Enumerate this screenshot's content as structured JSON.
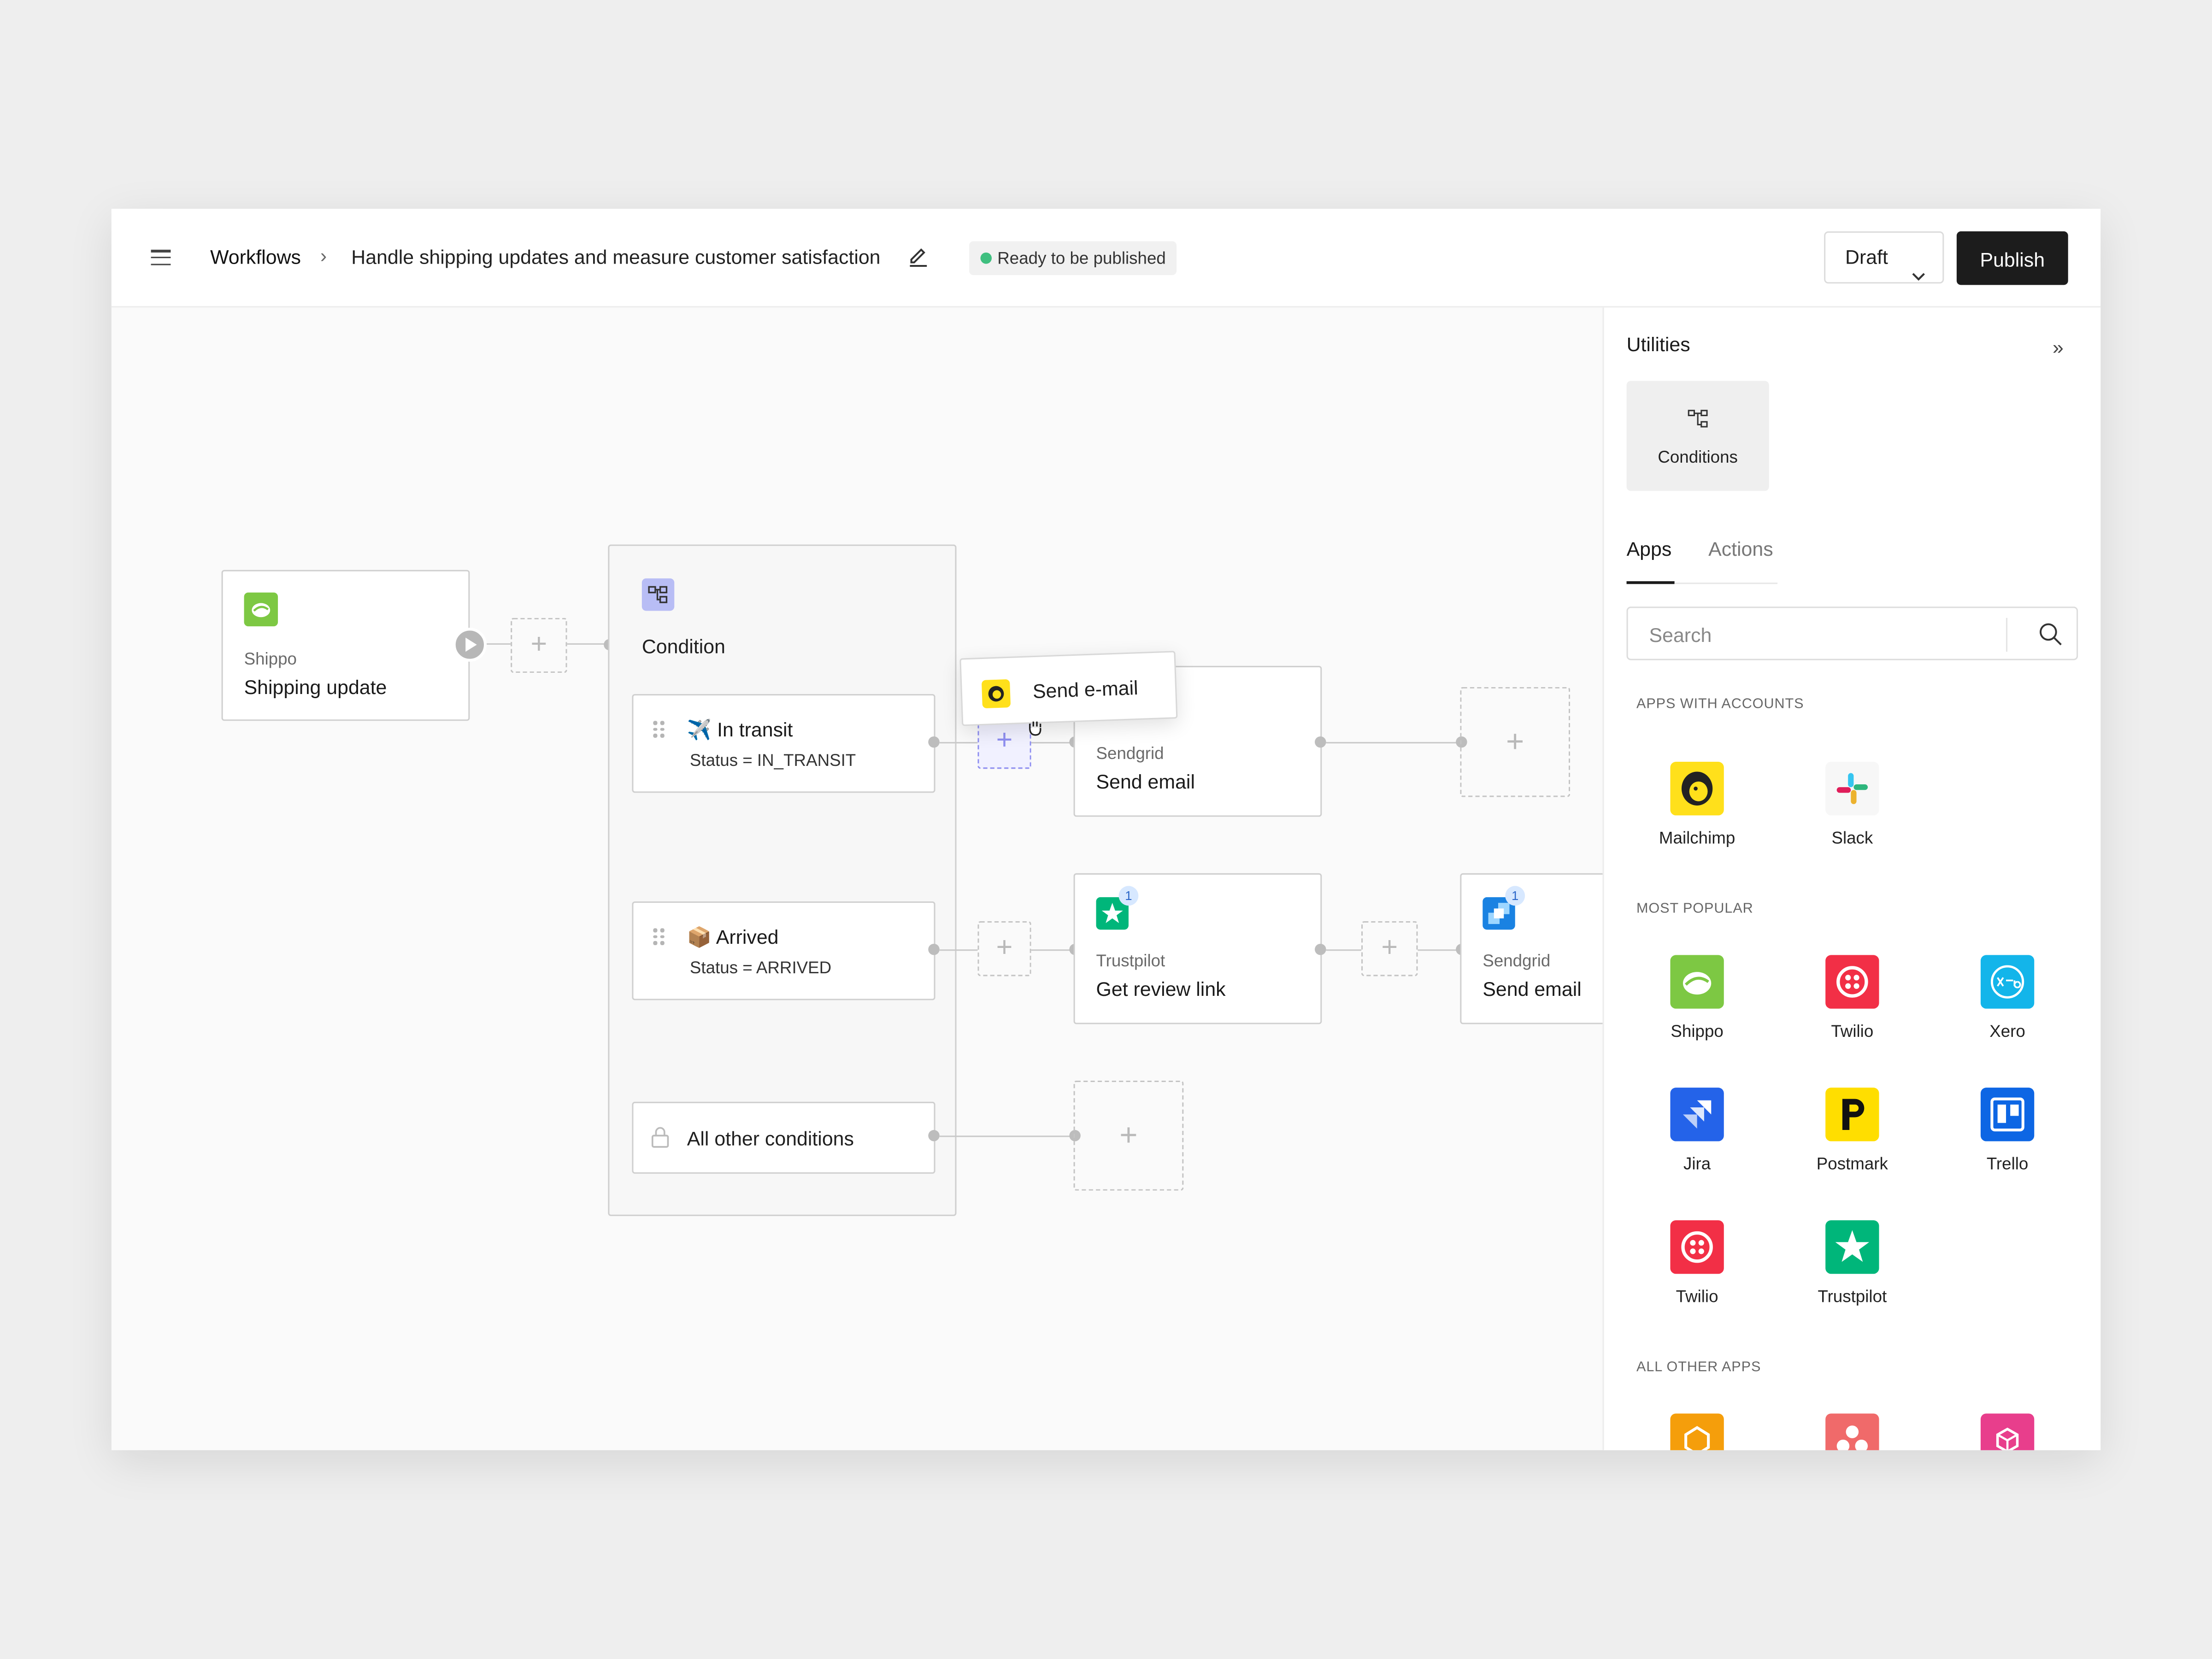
{
  "header": {
    "root_crumb": "Workflows",
    "separator": "›",
    "workflow_title": "Handle shipping updates and measure customer satisfaction",
    "status": "Ready to be published",
    "draft_label": "Draft",
    "publish_label": "Publish"
  },
  "canvas": {
    "trigger": {
      "app": "Shippo",
      "action": "Shipping update"
    },
    "condition": {
      "title": "Condition",
      "branches": [
        {
          "emoji": "✈️",
          "label": "In transit",
          "rule": "Status = IN_TRANSIT"
        },
        {
          "emoji": "📦",
          "label": "Arrived",
          "rule": "Status = ARRIVED"
        },
        {
          "label": "All other conditions"
        }
      ]
    },
    "drag_preview": {
      "label": "Send e-mail"
    },
    "steps": [
      {
        "app": "Sendgrid",
        "action": "Send email"
      },
      {
        "app": "Trustpilot",
        "action": "Get review link",
        "badge": "1"
      },
      {
        "app": "Sendgrid",
        "action": "Send email",
        "badge": "1"
      }
    ],
    "plus": "+"
  },
  "sidebar": {
    "title": "Utilities",
    "collapse_icon": "»",
    "utility_tile": "Conditions",
    "tabs": [
      {
        "label": "Apps"
      },
      {
        "label": "Actions"
      }
    ],
    "search_placeholder": "Search",
    "sections": {
      "with_accounts": "APPS WITH ACCOUNTS",
      "most_popular": "MOST POPULAR",
      "all_other": "ALL OTHER APPS"
    },
    "apps_with_accounts": [
      {
        "name": "Mailchimp"
      },
      {
        "name": "Slack"
      }
    ],
    "most_popular": [
      {
        "name": "Shippo"
      },
      {
        "name": "Twilio"
      },
      {
        "name": "Xero"
      },
      {
        "name": "Jira"
      },
      {
        "name": "Postmark"
      },
      {
        "name": "Trello"
      },
      {
        "name": "Twilio"
      },
      {
        "name": "Trustpilot"
      }
    ]
  },
  "colors": {
    "publish_bg": "#1c1c1c",
    "status_dot": "#3fbf7f",
    "shippo": "#7dc843",
    "twilio": "#f22f46",
    "xero": "#13b5ea",
    "jira": "#2463e9",
    "postmark": "#ffde00",
    "trello": "#0d66e4",
    "trustpilot": "#00b67a",
    "mailchimp": "#ffe01b",
    "condition_icon": "#b8bdf5"
  }
}
